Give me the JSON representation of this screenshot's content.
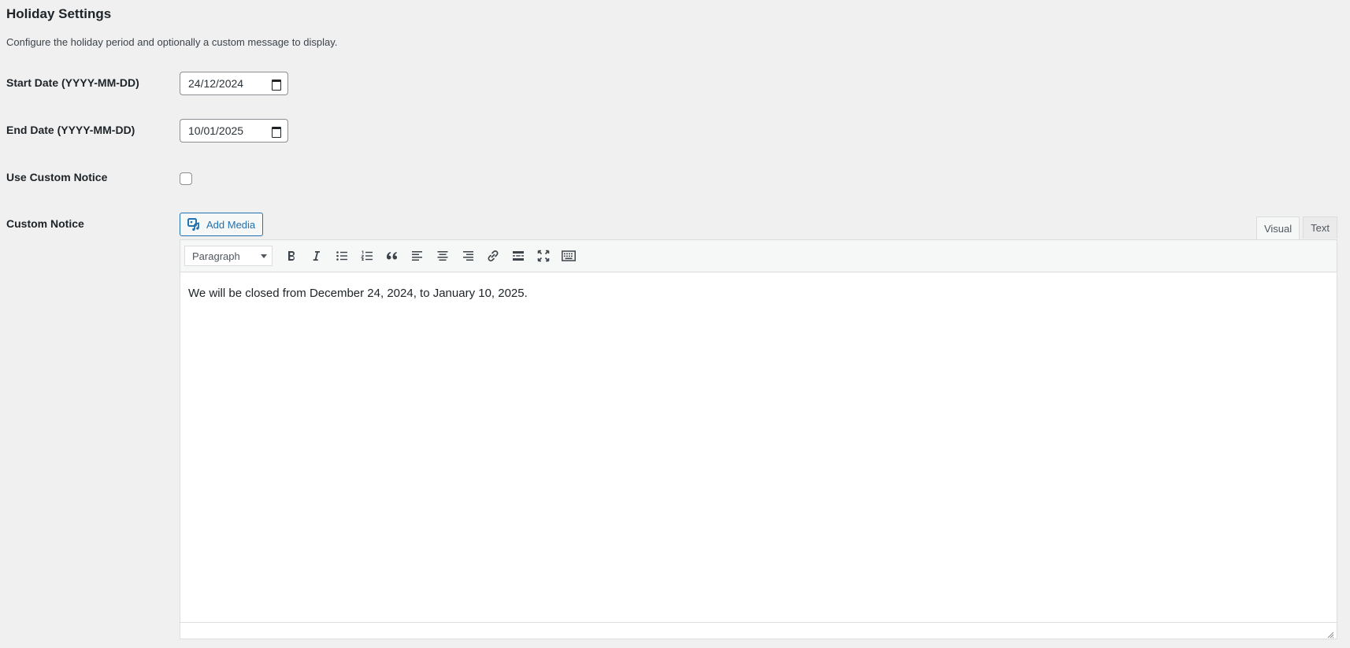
{
  "header": {
    "title": "Holiday Settings",
    "description": "Configure the holiday period and optionally a custom message to display."
  },
  "fields": {
    "start_date": {
      "label": "Start Date (YYYY-MM-DD)",
      "value": "24/12/2024"
    },
    "end_date": {
      "label": "End Date (YYYY-MM-DD)",
      "value": "10/01/2025"
    },
    "use_custom_notice": {
      "label": "Use Custom Notice",
      "checked": false
    },
    "custom_notice": {
      "label": "Custom Notice"
    }
  },
  "editor": {
    "add_media_label": "Add Media",
    "tabs": [
      {
        "label": "Visual",
        "active": true
      },
      {
        "label": "Text",
        "active": false
      }
    ],
    "format_select": "Paragraph",
    "toolbar_icons": [
      "bold-icon",
      "italic-icon",
      "bulleted-list-icon",
      "numbered-list-icon",
      "blockquote-icon",
      "align-left-icon",
      "align-center-icon",
      "align-right-icon",
      "link-icon",
      "read-more-icon",
      "fullscreen-icon",
      "toolbar-toggle-icon"
    ],
    "content": "We will be closed from December 24, 2024, to January 10, 2025."
  },
  "colors": {
    "accent": "#2271b1",
    "background": "#f0f0f1",
    "text": "#1d2327"
  }
}
